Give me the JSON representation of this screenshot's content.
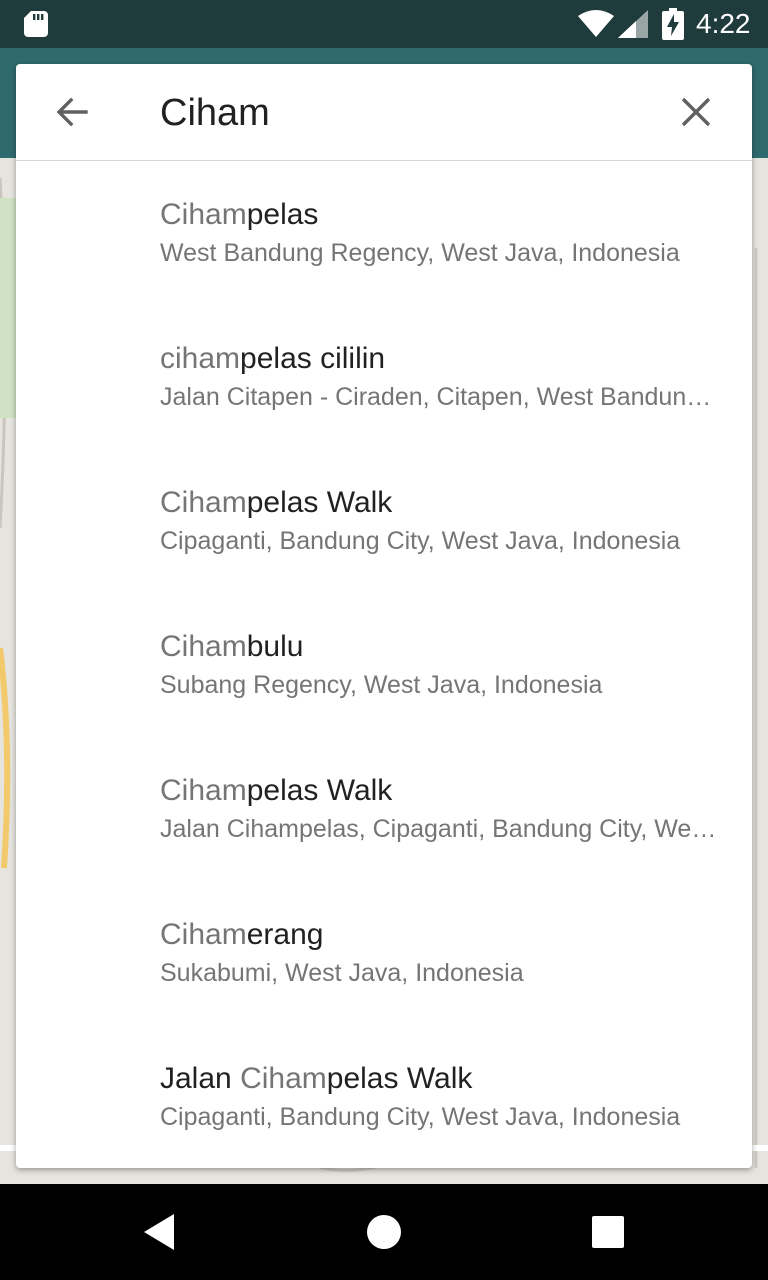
{
  "status_bar": {
    "time": "4:22",
    "icons": [
      "sd-card-icon",
      "wifi-icon",
      "cell-signal-icon",
      "battery-charging-icon"
    ]
  },
  "search": {
    "query": "Ciham",
    "back_icon": "arrow-back-icon",
    "clear_icon": "close-icon"
  },
  "results": [
    {
      "pre": "",
      "match": "Ciham",
      "post": "pelas",
      "subtitle": "West Bandung Regency, West Java, Indonesia"
    },
    {
      "pre": "",
      "match": "ciham",
      "post": "pelas cililin",
      "subtitle": "Jalan Citapen - Ciraden, Citapen, West Bandung Regency, West Java, Indonesia"
    },
    {
      "pre": "",
      "match": "Ciham",
      "post": "pelas Walk",
      "subtitle": "Cipaganti, Bandung City, West Java, Indonesia"
    },
    {
      "pre": "",
      "match": "Ciham",
      "post": "bulu",
      "subtitle": "Subang Regency, West Java, Indonesia"
    },
    {
      "pre": "",
      "match": "Ciham",
      "post": "pelas Walk",
      "subtitle": "Jalan Cihampelas, Cipaganti, Bandung City, West Java, Indonesia"
    },
    {
      "pre": "",
      "match": "Ciham",
      "post": "erang",
      "subtitle": "Sukabumi, West Java, Indonesia"
    },
    {
      "pre": "Jalan ",
      "match": "Ciham",
      "post": "pelas Walk",
      "subtitle": "Cipaganti, Bandung City, West Java, Indonesia"
    }
  ],
  "nav_bar": {
    "icons": [
      "nav-back-icon",
      "nav-home-icon",
      "nav-recents-icon"
    ]
  }
}
